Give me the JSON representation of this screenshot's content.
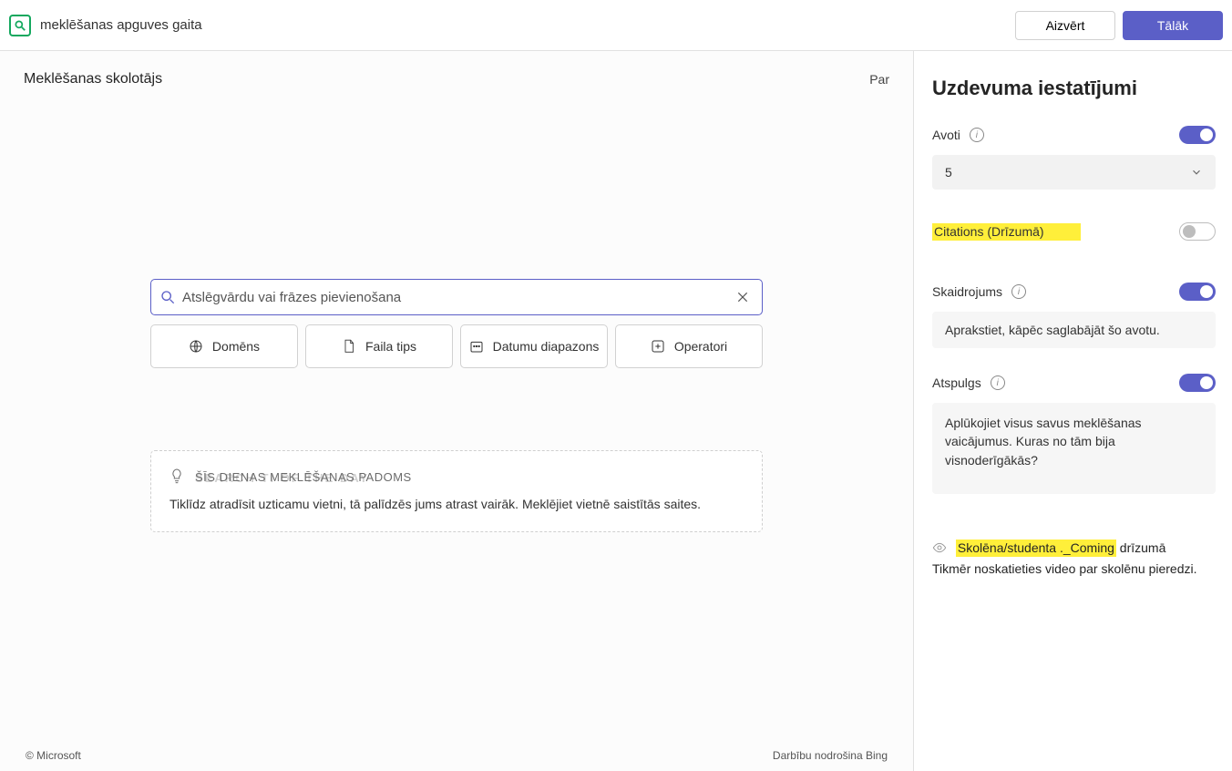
{
  "header": {
    "app_title": "meklēšanas apguves gaita",
    "close_label": "Aizvērt",
    "next_label": "Tālāk"
  },
  "sub_header": {
    "title": "Meklēšanas skolotājs",
    "about": "Par"
  },
  "search": {
    "placeholder": "Atslēgvārdu vai frāzes pievienošana"
  },
  "filters": {
    "domain": "Domēns",
    "filetype": "Faila tips",
    "daterange": "Datumu diapazons",
    "operators": "Operatori"
  },
  "tip": {
    "heading": "ŠĪS DIENAS MEKLĒŠANAS PADOMS",
    "ghost": "SEARCH TI   OF  THE DAY",
    "text": "Tiklīdz atradīsit uzticamu vietni, tā palīdzēs jums atrast vairāk. Meklējiet vietnē saistītās saites."
  },
  "footer": {
    "left": "© Microsoft",
    "right": "Darbību nodrošina Bing"
  },
  "side": {
    "title": "Uzdevuma iestatījumi",
    "sources_label": "Avoti",
    "sources_value": "5",
    "citations_label": "Citations (Drīzumā)",
    "explanation_label": "Skaidrojums",
    "explanation_value": "Aprakstiet, kāpēc saglabājāt šo avotu.",
    "reflection_label": "Atspulgs",
    "reflection_value": "Aplūkojiet visus savus meklēšanas vaicājumus. Kuras no tām bija visnoderīgākās?",
    "preview_hl": "Skolēna/studenta ._Coming",
    "preview_rest": " drīzumā",
    "preview_line2": "Tikmēr noskatieties video par skolēnu pieredzi."
  }
}
